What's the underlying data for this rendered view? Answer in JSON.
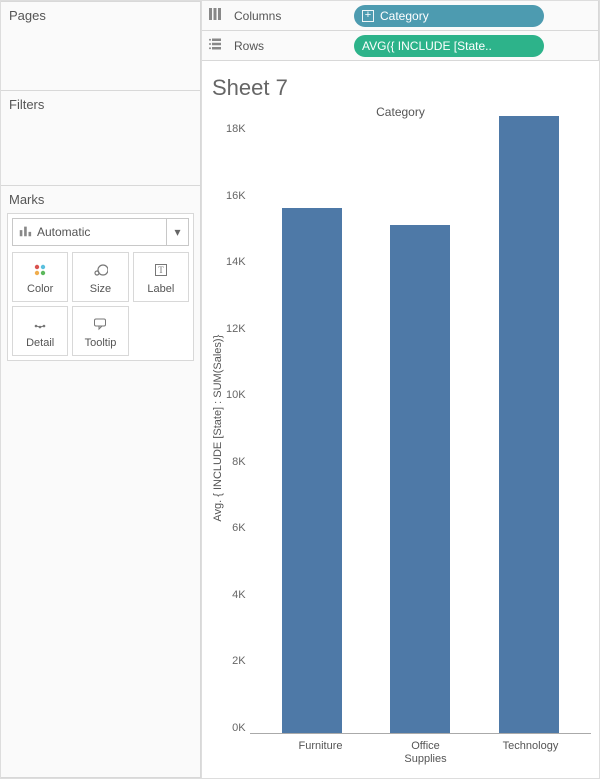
{
  "panels": {
    "pages": "Pages",
    "filters": "Filters",
    "marks": "Marks"
  },
  "marks": {
    "type_label": "Automatic",
    "cards": [
      {
        "name": "color",
        "label": "Color"
      },
      {
        "name": "size",
        "label": "Size"
      },
      {
        "name": "label",
        "label": "Label"
      },
      {
        "name": "detail",
        "label": "Detail"
      },
      {
        "name": "tooltip",
        "label": "Tooltip"
      }
    ]
  },
  "shelves": {
    "columns_label": "Columns",
    "rows_label": "Rows",
    "columns_pill": "Category",
    "rows_pill": "AVG({ INCLUDE [State.."
  },
  "viz": {
    "sheet_title": "Sheet 7",
    "top_label": "Category",
    "y_axis_title": "Avg. { INCLUDE [State] : SUM(Sales)}"
  },
  "chart_data": {
    "type": "bar",
    "title": "Category",
    "xlabel": "",
    "ylabel": "Avg. { INCLUDE [State] : SUM(Sales)}",
    "ylim": [
      0,
      18000
    ],
    "y_ticks": [
      "18K",
      "16K",
      "14K",
      "12K",
      "10K",
      "8K",
      "6K",
      "4K",
      "2K",
      "0K"
    ],
    "categories": [
      "Furniture",
      "Office Supplies",
      "Technology"
    ],
    "values": [
      15500,
      15000,
      18200
    ],
    "bar_color": "#4e79a7"
  }
}
